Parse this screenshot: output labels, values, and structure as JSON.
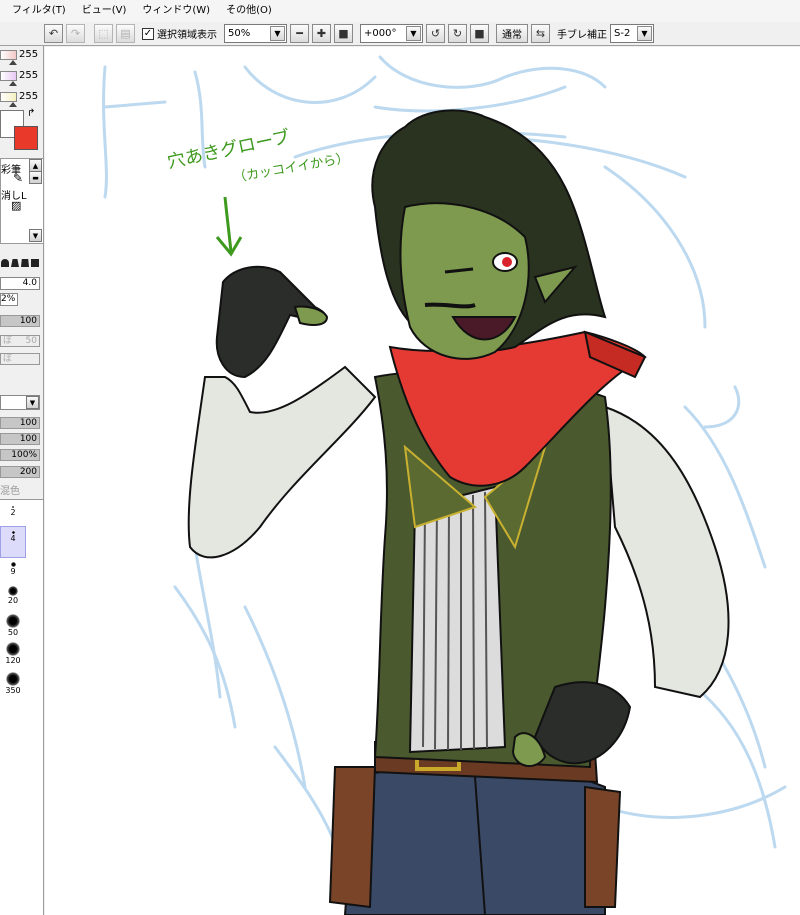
{
  "menubar": {
    "items": [
      "フィルタ(T)",
      "ビュー(V)",
      "ウィンドウ(W)",
      "その他(O)"
    ]
  },
  "toolbar": {
    "selection_checkbox_label": "選択領域表示",
    "zoom_value": "50%",
    "rotation_value": "+000°",
    "blend_mode_label": "通常",
    "stabilizer_label": "手ブレ補正",
    "stabilizer_value": "S-2"
  },
  "sidebar": {
    "rgb_values": [
      "255",
      "255",
      "255"
    ],
    "tool_panel_lines": [
      "彩筆",
      "消しL"
    ],
    "brush_size_value": "4.0",
    "brush_min_size_value": "2%",
    "density_value": "100",
    "dim_label": "ぼ",
    "dim_value": "50",
    "dim_label2": "ぼ",
    "value_bars": [
      "100",
      "100",
      "100%",
      "200"
    ],
    "mix_label": "混色",
    "brush_sizes": [
      "2",
      "4",
      "9",
      "20",
      "50",
      "120",
      "350"
    ]
  },
  "canvas": {
    "annotation": "穴あきグローブ",
    "annotation_sub": "（カッコイイから）"
  },
  "colors": {
    "primary": "#e8392b",
    "secondary": "#ffffff",
    "skin": "#7e9a4e",
    "vest": "#4a5a2e",
    "scarf": "#e53a33",
    "sketch": "#bcd9f0",
    "annotation": "#3e9a1e"
  }
}
